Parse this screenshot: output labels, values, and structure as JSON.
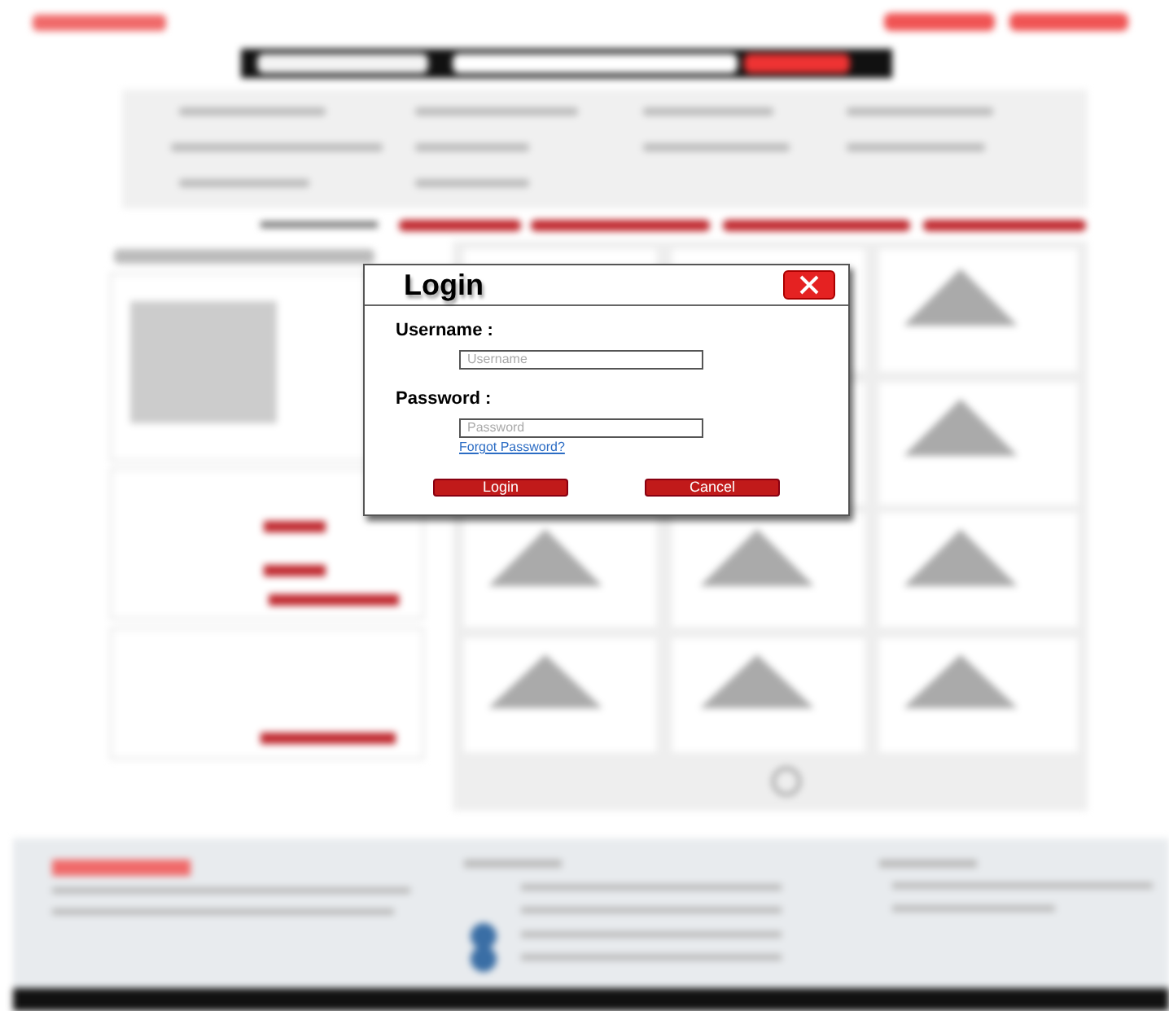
{
  "dialog": {
    "title": "Login",
    "fields": [
      {
        "label": "Username :",
        "placeholder": "Username"
      },
      {
        "label": "Password :",
        "placeholder": "Password"
      }
    ],
    "forgot_link": "Forgot Password?",
    "buttons": [
      "Login",
      "Cancel"
    ]
  }
}
